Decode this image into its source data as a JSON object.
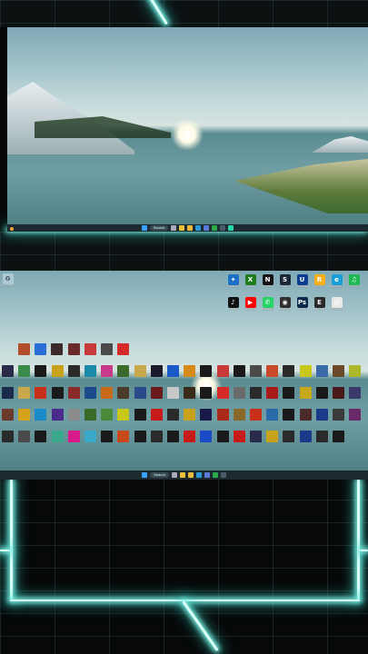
{
  "top_screen": {
    "taskbar": {
      "weather_label": "",
      "search_placeholder": "Search",
      "clock_time": "",
      "clock_date": ""
    }
  },
  "bottom_screen": {
    "desktop": {
      "recycle_bin_label": "Recycle Bin",
      "top_right_apps": [
        {
          "label": "Visual Studio Code",
          "icon": "vscode-icon",
          "color": "#1b6fc4",
          "glyph": "✦"
        },
        {
          "label": "Xbox",
          "icon": "xbox-icon",
          "color": "#1e7b1e",
          "glyph": "X"
        },
        {
          "label": "Netflix",
          "icon": "netflix-icon",
          "color": "#141414",
          "glyph": "N"
        },
        {
          "label": "Steam",
          "icon": "steam-icon",
          "color": "#1b2838",
          "glyph": "S"
        },
        {
          "label": "Ubisoft Connect",
          "icon": "ubisoft-icon",
          "color": "#0a3d8f",
          "glyph": "U"
        },
        {
          "label": "Rockstar Games",
          "icon": "rockstar-icon",
          "color": "#fcaf17",
          "glyph": "R"
        },
        {
          "label": "Microsoft Edge",
          "icon": "edge-icon",
          "color": "#1a9fd6",
          "glyph": "e"
        },
        {
          "label": "Spotify",
          "icon": "spotify-icon",
          "color": "#1db954",
          "glyph": "♫"
        },
        {
          "label": "TikTok",
          "icon": "tiktok-icon",
          "color": "#111111",
          "glyph": "♪"
        },
        {
          "label": "YouTube",
          "icon": "youtube-icon",
          "color": "#ff0000",
          "glyph": "▶"
        },
        {
          "label": "WhatsApp",
          "icon": "whatsapp-icon",
          "color": "#25d366",
          "glyph": "✆"
        },
        {
          "label": "OBS Studio",
          "icon": "obs-icon",
          "color": "#302e31",
          "glyph": "◉"
        },
        {
          "label": "Photoshop",
          "icon": "photoshop-icon",
          "color": "#0a2b4b",
          "glyph": "Ps"
        },
        {
          "label": "Epic Games",
          "icon": "epic-icon",
          "color": "#2a2a2a",
          "glyph": "E"
        },
        {
          "label": "Google Chrome",
          "icon": "chrome-icon",
          "color": "#e8e8e8",
          "glyph": "◎"
        }
      ],
      "game_grid_colors": [
        [
          "#b24f2a",
          "#2a6fd6",
          "#3a2a2a",
          "#6a2a2a",
          "#c63a3a",
          "#4a4a4a",
          "#d62a2a"
        ],
        [
          "#2a2a4a",
          "#3a8a4a",
          "#1a1a1a",
          "#c8a21a",
          "#2a2a2a",
          "#1a8aa8",
          "#c83a8a",
          "#3a6a2a",
          "#c8a84a",
          "#1a1a2a",
          "#1a5ac8",
          "#d68a1a",
          "#1a1a1a",
          "#c83a3a",
          "#1a1a1a",
          "#4a4a4a",
          "#c84a2a",
          "#2a2a2a",
          "#c8c81a",
          "#3a6aa8",
          "#6a4a2a",
          "#aab82a"
        ],
        [
          "#1a2a4a",
          "#c8a84a",
          "#c8301a",
          "#1a1a1a",
          "#8a2a2a",
          "#1a4a8a",
          "#c86a1a",
          "#4a3a2a",
          "#2a4a8a",
          "#6a1a1a",
          "#c8c8c8",
          "#3a2a1a",
          "#1a1a1a",
          "#d62a2a",
          "#6a6a6a",
          "#2a2a2a",
          "#a81a1a",
          "#1a1a1a",
          "#c8a81a",
          "#1a1a1a",
          "#4a1a1a",
          "#3a3a6a"
        ],
        [
          "#6a3a2a",
          "#d6a21a",
          "#1a8ac8",
          "#4a2a8a",
          "#8a8a8a",
          "#3a6a2a",
          "#4a8a3a",
          "#c8c81a",
          "#1a1a1a",
          "#c81a1a",
          "#2a2a2a",
          "#c8a21a",
          "#1a1a4a",
          "#aa2a1a",
          "#8a6a2a",
          "#c8301a",
          "#2a6aa8",
          "#1a1a1a",
          "#4a2a2a",
          "#1a3a8a",
          "#3a3a3a",
          "#6a2a6a"
        ],
        [
          "#2a2a2a",
          "#4a4a4a",
          "#1a1a1a",
          "#3aa88a",
          "#d61a8a",
          "#3aa8c8",
          "#1a1a1a",
          "#c84a1a",
          "#1a1a1a",
          "#2a2a2a",
          "#1a1a1a",
          "#c81a1a",
          "#1a4ac8",
          "#1a1a1a",
          "#c81a1a",
          "#2a2a4a",
          "#c8a21a",
          "#2a2a2a",
          "#1a3a8a",
          "#2a2a2a",
          "#1a1a1a"
        ]
      ]
    },
    "taskbar": {
      "search_placeholder": "Search"
    }
  },
  "colors": {
    "glow": "#7ff2e6",
    "taskbar": "#1d2a30"
  }
}
